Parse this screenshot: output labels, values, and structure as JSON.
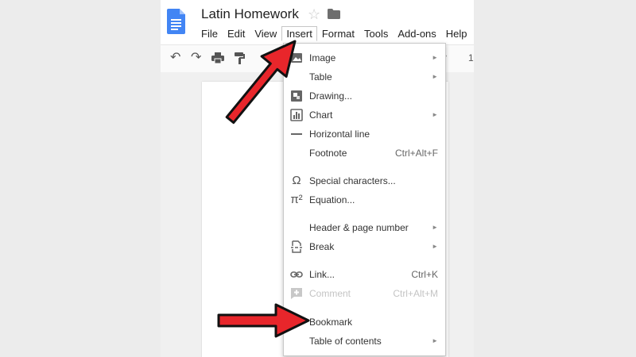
{
  "document": {
    "title": "Latin Homework"
  },
  "icons": {
    "docs": "docs-icon",
    "star": "star-icon",
    "folder": "folder-icon",
    "undo": "undo-icon",
    "redo": "redo-icon",
    "print": "print-icon",
    "paint": "paint-format-icon",
    "annotation": "red-arrow-icon"
  },
  "menubar": [
    "File",
    "Edit",
    "View",
    "Insert",
    "Format",
    "Tools",
    "Add-ons",
    "Help"
  ],
  "toolbar": {
    "font_size": "1"
  },
  "insert_menu": {
    "items": [
      {
        "label": "Image",
        "icon": "image-icon",
        "submenu": true
      },
      {
        "label": "Table",
        "submenu": true
      },
      {
        "label": "Drawing...",
        "icon": "drawing-icon"
      },
      {
        "label": "Chart",
        "icon": "chart-icon",
        "submenu": true
      },
      {
        "label": "Horizontal line",
        "icon": "horizontal-line-icon"
      },
      {
        "label": "Footnote",
        "shortcut": "Ctrl+Alt+F"
      },
      {
        "label": "Special characters...",
        "icon": "omega-icon"
      },
      {
        "label": "Equation...",
        "icon": "pi-icon"
      },
      {
        "label": "Header & page number",
        "submenu": true
      },
      {
        "label": "Break",
        "icon": "break-icon",
        "submenu": true
      },
      {
        "label": "Link...",
        "icon": "link-icon",
        "shortcut": "Ctrl+K"
      },
      {
        "label": "Comment",
        "icon": "comment-icon",
        "shortcut": "Ctrl+Alt+M",
        "disabled": true
      },
      {
        "label": "Bookmark"
      },
      {
        "label": "Table of contents",
        "submenu": true
      }
    ]
  },
  "colors": {
    "docs_blue": "#4285f4",
    "arrow_red": "#e8262b",
    "menu_border": "#c9c9c9"
  }
}
